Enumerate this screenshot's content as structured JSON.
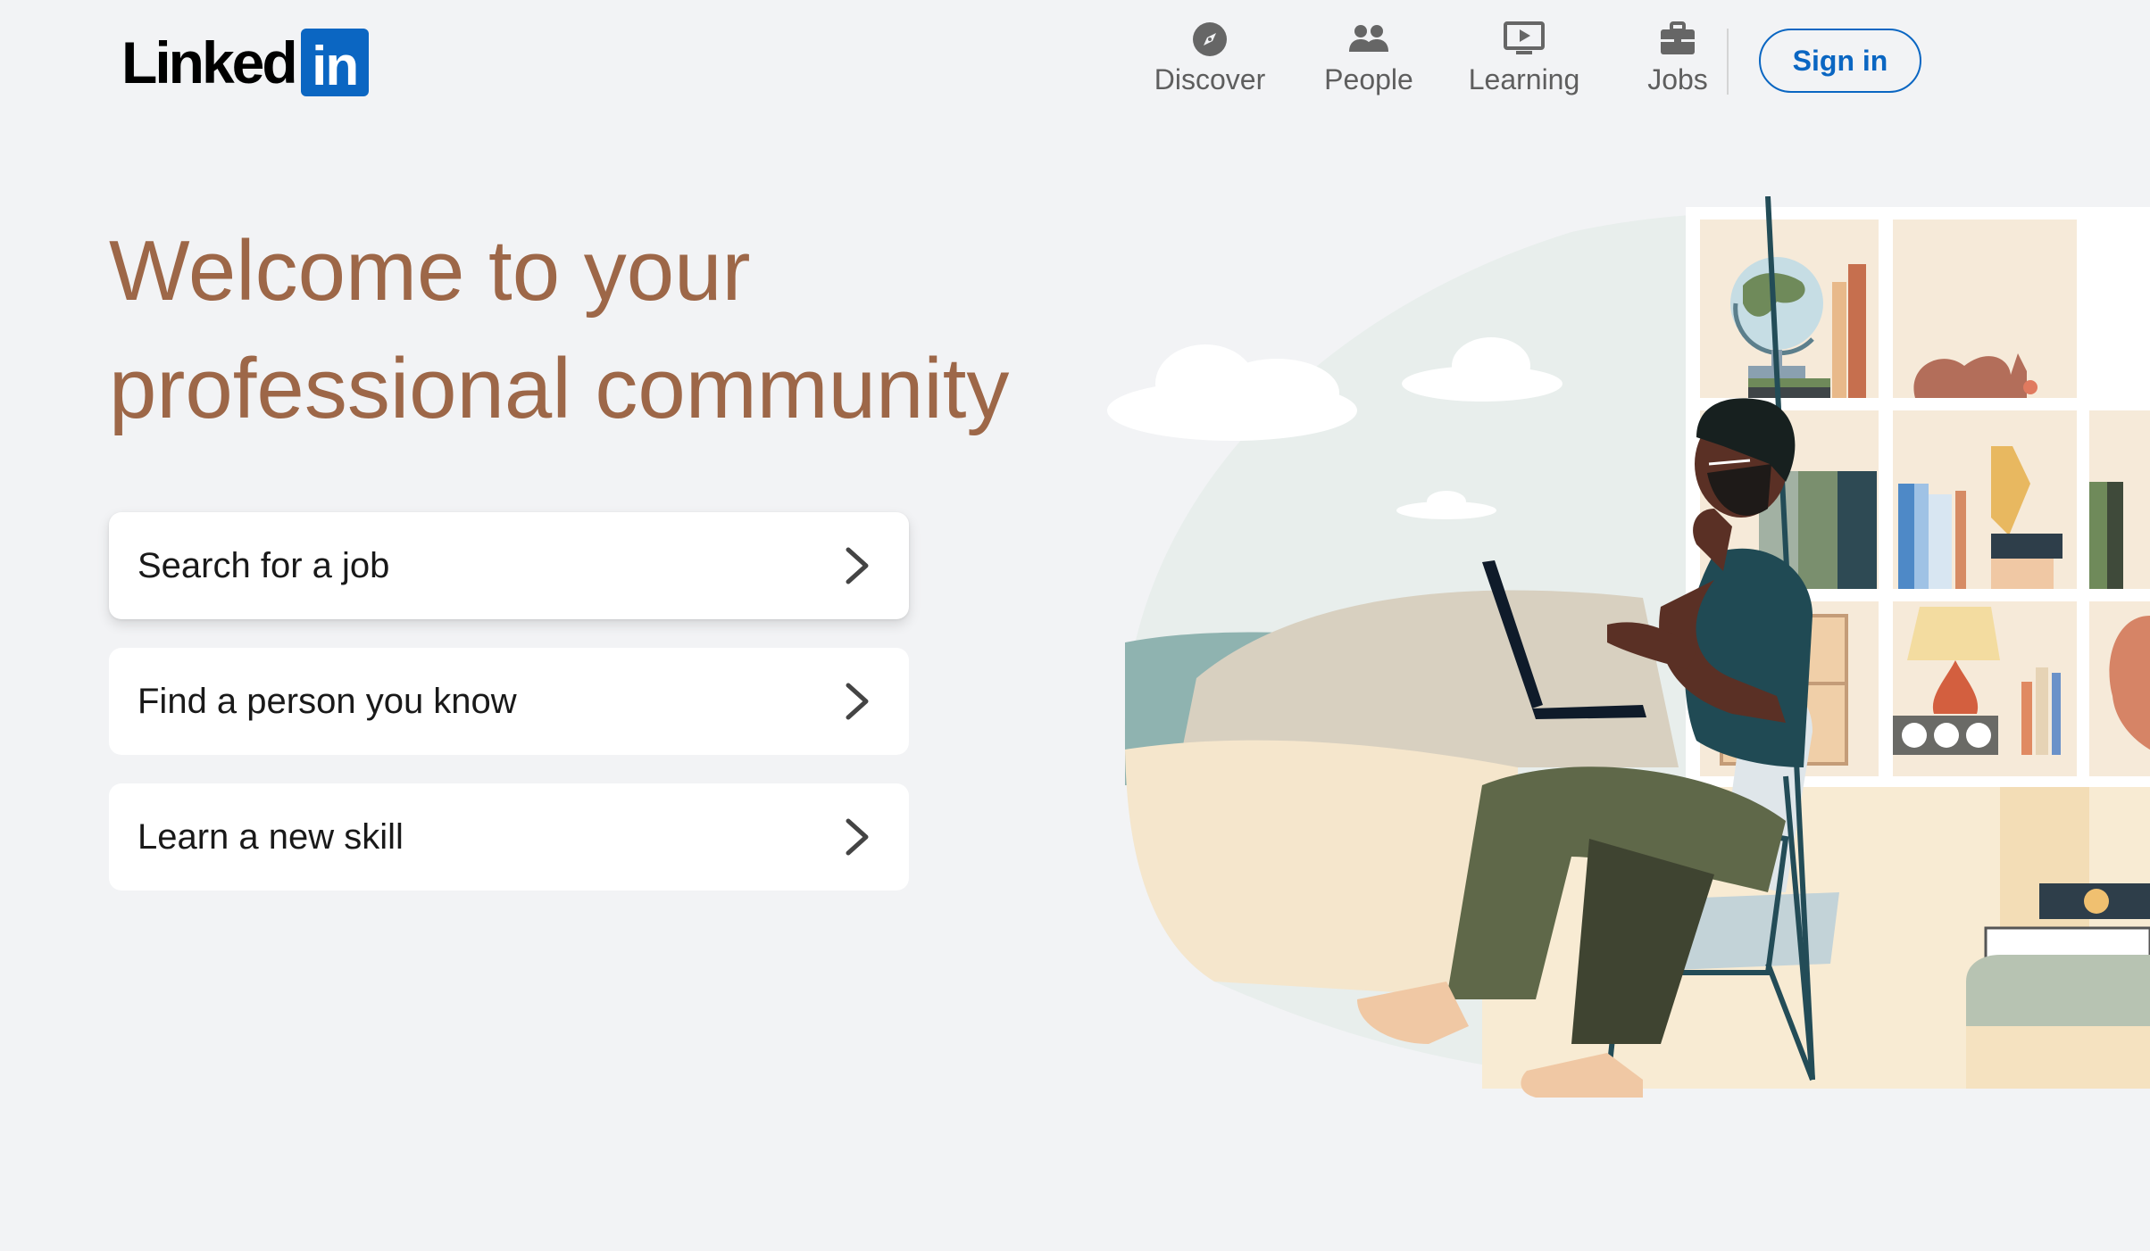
{
  "header": {
    "logo_word": "Linked",
    "logo_box": "in",
    "nav": [
      {
        "label": "Discover",
        "icon": "compass-icon"
      },
      {
        "label": "People",
        "icon": "people-icon"
      },
      {
        "label": "Learning",
        "icon": "play-screen-icon"
      },
      {
        "label": "Jobs",
        "icon": "briefcase-icon"
      }
    ],
    "signin_label": "Sign in"
  },
  "hero": {
    "title_line1": "Welcome to your",
    "title_line2": "professional community"
  },
  "actions": [
    {
      "label": "Search for a job",
      "icon": "chevron-right-icon"
    },
    {
      "label": "Find a person you know",
      "icon": "chevron-right-icon"
    },
    {
      "label": "Learn a new skill",
      "icon": "chevron-right-icon"
    }
  ],
  "colors": {
    "brand_blue": "#0a66c2",
    "title_brown": "#9d6748",
    "background": "#f2f3f5"
  }
}
